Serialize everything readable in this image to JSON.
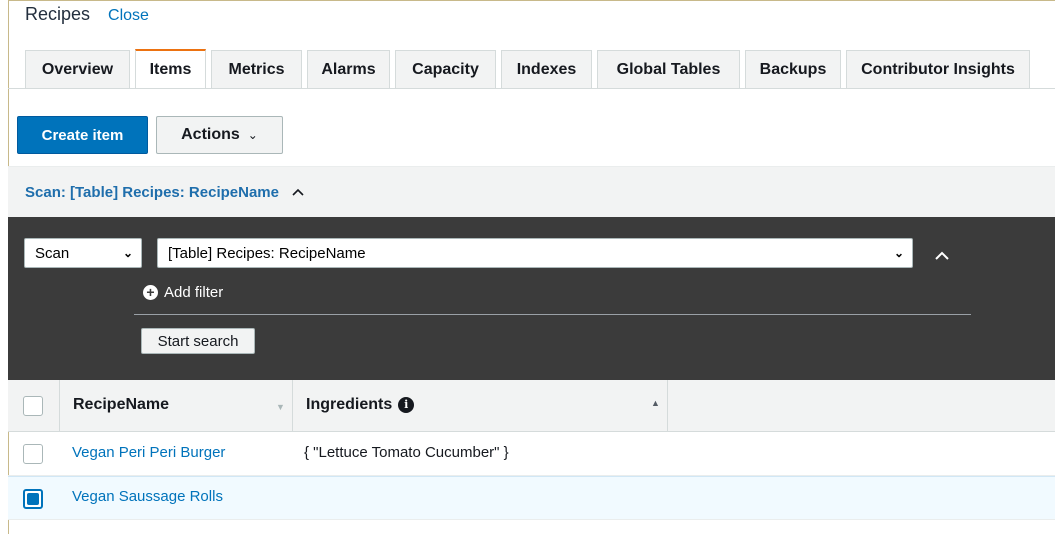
{
  "header": {
    "title": "Recipes",
    "close_label": "Close"
  },
  "tabs": [
    {
      "label": "Overview",
      "active": false
    },
    {
      "label": "Items",
      "active": true
    },
    {
      "label": "Metrics",
      "active": false
    },
    {
      "label": "Alarms",
      "active": false
    },
    {
      "label": "Capacity",
      "active": false
    },
    {
      "label": "Indexes",
      "active": false
    },
    {
      "label": "Global Tables",
      "active": false
    },
    {
      "label": "Backups",
      "active": false
    },
    {
      "label": "Contributor Insights",
      "active": false
    }
  ],
  "toolbar": {
    "create_item_label": "Create item",
    "actions_label": "Actions"
  },
  "scan": {
    "header_text": "Scan: [Table] Recipes: RecipeName",
    "mode_value": "Scan",
    "source_value": "[Table] Recipes: RecipeName",
    "add_filter_label": "Add filter",
    "start_search_label": "Start search"
  },
  "table": {
    "columns": [
      {
        "label": "RecipeName"
      },
      {
        "label": "Ingredients"
      }
    ],
    "rows": [
      {
        "recipe_name": "Vegan Peri Peri Burger",
        "ingredients": "{ \"Lettuce Tomato Cucumber\" }",
        "selected": false
      },
      {
        "recipe_name": "Vegan Saussage Rolls",
        "ingredients": "",
        "selected": true
      }
    ]
  },
  "colors": {
    "accent": "#0073bb",
    "tab_active_border": "#ec7211",
    "panel_bg": "#3b3b3b"
  }
}
